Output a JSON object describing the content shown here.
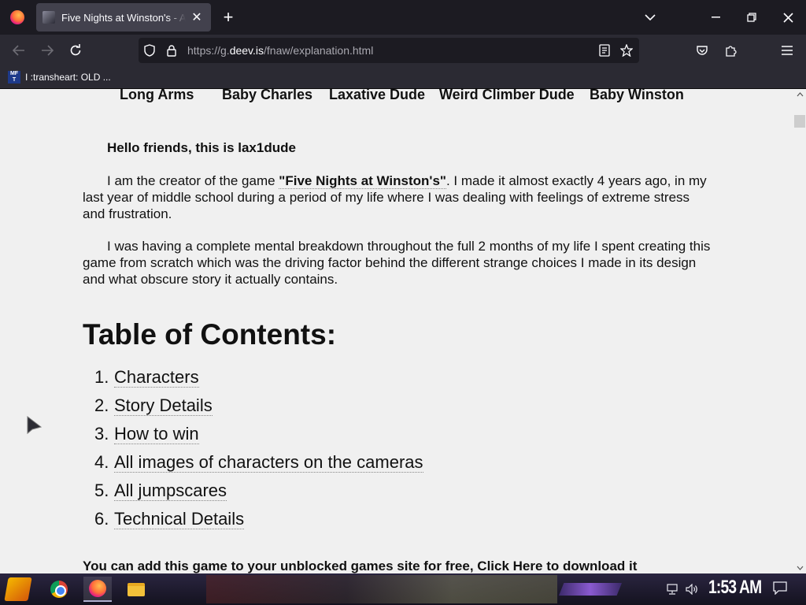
{
  "browser": {
    "tab_title": "Five Nights at Winston's - An",
    "tab_close": "✕",
    "new_tab": "+",
    "url_prefix": "https://g.",
    "url_domain": "deev.is",
    "url_path": "/fnaw/explanation.html",
    "bookmark_label": "I :transheart: OLD ...",
    "bookmark_favicon_text": "MF T"
  },
  "page": {
    "character_nav": [
      "Long Arms",
      "Baby Charles",
      "Laxative Dude",
      "Weird Climber Dude",
      "Baby Winston"
    ],
    "greeting": "Hello friends, this is lax1dude",
    "para1_before": "I am the creator of the game ",
    "para1_bold": "\"Five Nights at Winston's\"",
    "para1_after": ". I made it almost exactly 4 years ago, in my last year of middle school during a period of my life where I was dealing with feelings of extreme stress and frustration.",
    "para2": "I was having a complete mental breakdown throughout the full 2 months of my life I spent creating this game from scratch which was the driving factor behind the different strange choices I made in its design and what obscure story it actually contains.",
    "toc_heading": "Table of Contents:",
    "toc": [
      {
        "num": "1.",
        "label": "Characters"
      },
      {
        "num": "2.",
        "label": "Story Details"
      },
      {
        "num": "3.",
        "label": "How to win"
      },
      {
        "num": "4.",
        "label": "All images of characters on the cameras"
      },
      {
        "num": "5.",
        "label": "All jumpscares"
      },
      {
        "num": "6.",
        "label": "Technical Details"
      }
    ],
    "bottom_before": "You can add this game to your unblocked games site for free, ",
    "bottom_link": "Click Here",
    "bottom_after": " to download it"
  },
  "taskbar": {
    "clock": "1:53 AM"
  },
  "colors": {
    "tab_bar": "#1c1b22",
    "nav_bar": "#2b2a33",
    "page_bg": "#f0f0f0"
  }
}
